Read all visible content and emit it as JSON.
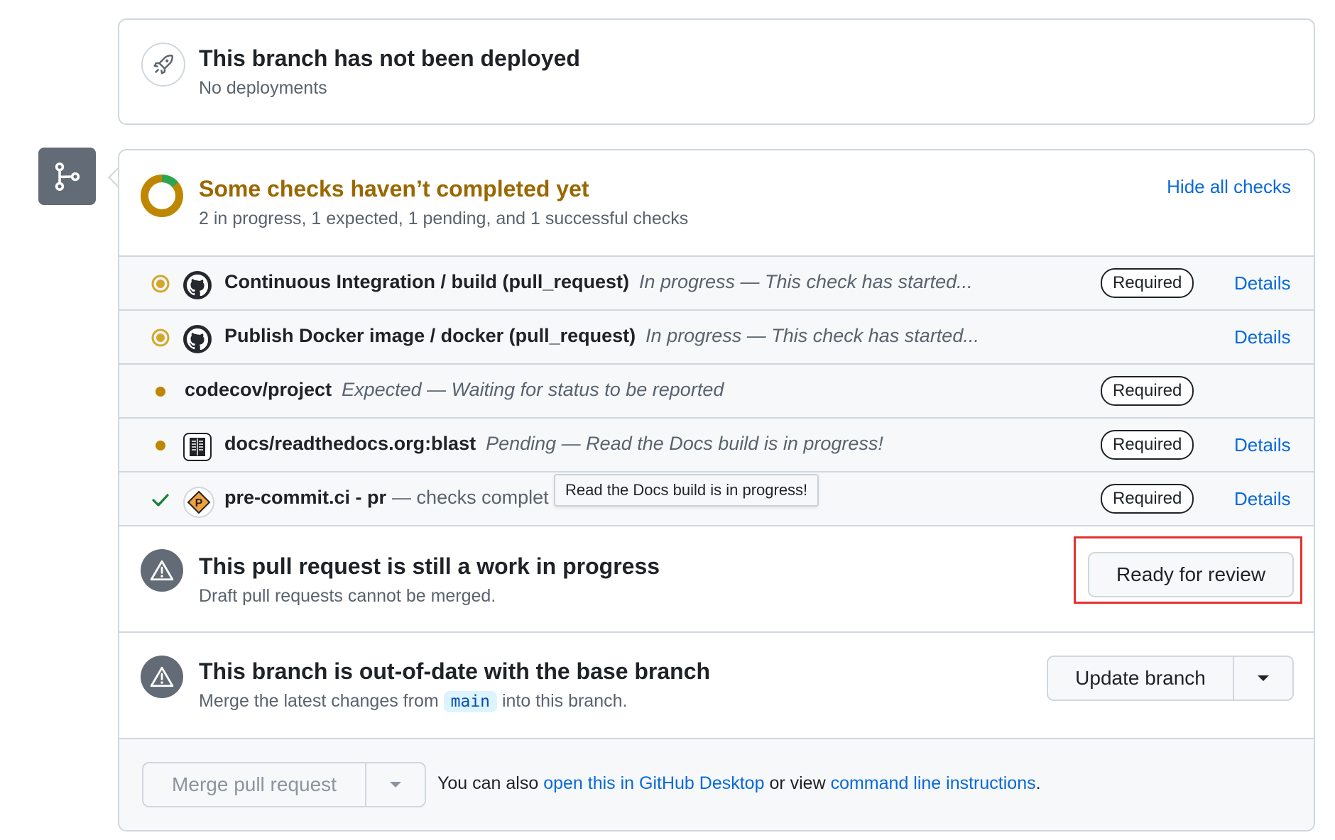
{
  "deployment": {
    "title": "This branch has not been deployed",
    "subtitle": "No deployments",
    "icon": "rocket-icon"
  },
  "checks": {
    "title": "Some checks haven’t completed yet",
    "summary": "2 in progress, 1 expected, 1 pending, and 1 successful checks",
    "hide_link": "Hide all checks",
    "title_color": "#9a6700",
    "rows": [
      {
        "name": "Continuous Integration / build (pull_request)",
        "desc": "In progress — This check has started...",
        "required": "Required",
        "details": "Details",
        "status": "in-progress",
        "app_icon": "github-icon"
      },
      {
        "name": "Publish Docker image / docker (pull_request)",
        "desc": "In progress — This check has started...",
        "required": "",
        "details": "Details",
        "status": "in-progress",
        "app_icon": "github-icon"
      },
      {
        "name": "codecov/project",
        "desc": "Expected — Waiting for status to be reported",
        "required": "Required",
        "details": "",
        "status": "expected",
        "app_icon": ""
      },
      {
        "name": "docs/readthedocs.org:blast",
        "desc": "Pending — Read the Docs build is in progress!",
        "required": "Required",
        "details": "Details",
        "status": "pending",
        "app_icon": "readthedocs-icon"
      },
      {
        "name": "pre-commit.ci - pr",
        "desc": "— checks complet",
        "required": "Required",
        "details": "Details",
        "status": "success",
        "app_icon": "pre-commit-icon"
      }
    ],
    "tooltip": "Read the Docs build is in progress!"
  },
  "draft": {
    "title": "This pull request is still a work in progress",
    "subtitle": "Draft pull requests cannot be merged.",
    "button": "Ready for review"
  },
  "outdated": {
    "title": "This branch is out-of-date with the base branch",
    "sub_before": "Merge the latest changes from",
    "branch": "main",
    "sub_after": "into this branch.",
    "button": "Update branch"
  },
  "merge": {
    "button": "Merge pull request",
    "text_1": "You can also",
    "link_1": "open this in GitHub Desktop",
    "text_2": "or view",
    "link_2": "command line instructions",
    "text_3": "."
  }
}
